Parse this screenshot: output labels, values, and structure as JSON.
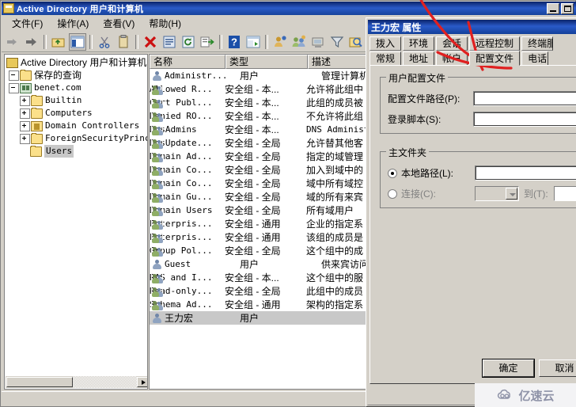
{
  "main_window": {
    "title": "Active Directory 用户和计算机",
    "window_buttons": [
      "minimize",
      "maximize"
    ],
    "menu": [
      {
        "label": "文件(F)"
      },
      {
        "label": "操作(A)"
      },
      {
        "label": "查看(V)"
      },
      {
        "label": "帮助(H)"
      }
    ],
    "toolbar_icons": [
      "back-arrow-icon",
      "forward-arrow-icon",
      "separator",
      "up-folder-icon",
      "show-hide-tree-icon",
      "separator",
      "cut-icon",
      "copy-paste-icon",
      "separator",
      "delete-icon",
      "properties-icon",
      "refresh-icon",
      "export-list-icon",
      "separator",
      "help-icon",
      "console-window-icon",
      "separator",
      "new-user-icon",
      "new-group-icon",
      "new-computer-icon",
      "filter-icon",
      "find-icon",
      "find-users-icon"
    ]
  },
  "tree": {
    "nodes": [
      {
        "label": "Active Directory 用户和计算机",
        "icon": "console-root-icon",
        "indent": 0,
        "twisty": "none",
        "selected": false,
        "cjk": true
      },
      {
        "label": "保存的查询",
        "icon": "folder-icon",
        "indent": 1,
        "twisty": "expand",
        "selected": false,
        "cjk": true
      },
      {
        "label": "benet.com",
        "icon": "domain-icon",
        "indent": 1,
        "twisty": "expand",
        "selected": false,
        "cjk": false
      },
      {
        "label": "Builtin",
        "icon": "folder-icon",
        "indent": 2,
        "twisty": "collapse",
        "selected": false,
        "cjk": false
      },
      {
        "label": "Computers",
        "icon": "folder-icon",
        "indent": 2,
        "twisty": "collapse",
        "selected": false,
        "cjk": false
      },
      {
        "label": "Domain Controllers",
        "icon": "ou-folder-icon",
        "indent": 2,
        "twisty": "collapse",
        "selected": false,
        "cjk": false
      },
      {
        "label": "ForeignSecurityPrincipals",
        "icon": "folder-icon",
        "indent": 2,
        "twisty": "collapse",
        "selected": false,
        "cjk": false
      },
      {
        "label": "Users",
        "icon": "folder-icon",
        "indent": 2,
        "twisty": "none",
        "selected": true,
        "cjk": false
      }
    ]
  },
  "list": {
    "columns": [
      {
        "label": "名称"
      },
      {
        "label": "类型"
      },
      {
        "label": "描述"
      }
    ],
    "rows": [
      {
        "name": "Administr...",
        "type": "用户",
        "desc": "管理计算机 (",
        "icon": "user-icon",
        "selected": false,
        "cjk_name": false,
        "mono_desc": false
      },
      {
        "name": "Allowed R...",
        "type": "安全组 - 本...",
        "desc": "允许将此组中",
        "icon": "group-icon",
        "selected": false,
        "cjk_name": false,
        "mono_desc": false
      },
      {
        "name": "Cert Publ...",
        "type": "安全组 - 本...",
        "desc": "此组的成员被",
        "icon": "group-icon",
        "selected": false,
        "cjk_name": false,
        "mono_desc": false
      },
      {
        "name": "Denied RO...",
        "type": "安全组 - 本...",
        "desc": "不允许将此组",
        "icon": "group-icon",
        "selected": false,
        "cjk_name": false,
        "mono_desc": false
      },
      {
        "name": "DnsAdmins",
        "type": "安全组 - 本...",
        "desc": "DNS Administ",
        "icon": "group-icon",
        "selected": false,
        "cjk_name": false,
        "mono_desc": true
      },
      {
        "name": "DnsUpdate...",
        "type": "安全组 - 全局",
        "desc": "允许替其他客",
        "icon": "group-icon",
        "selected": false,
        "cjk_name": false,
        "mono_desc": false
      },
      {
        "name": "Domain Ad...",
        "type": "安全组 - 全局",
        "desc": "指定的域管理",
        "icon": "group-icon",
        "selected": false,
        "cjk_name": false,
        "mono_desc": false
      },
      {
        "name": "Domain Co...",
        "type": "安全组 - 全局",
        "desc": "加入到域中的",
        "icon": "group-icon",
        "selected": false,
        "cjk_name": false,
        "mono_desc": false
      },
      {
        "name": "Domain Co...",
        "type": "安全组 - 全局",
        "desc": "域中所有域控",
        "icon": "group-icon",
        "selected": false,
        "cjk_name": false,
        "mono_desc": false
      },
      {
        "name": "Domain Gu...",
        "type": "安全组 - 全局",
        "desc": "域的所有来宾",
        "icon": "group-icon",
        "selected": false,
        "cjk_name": false,
        "mono_desc": false
      },
      {
        "name": "Domain Users",
        "type": "安全组 - 全局",
        "desc": "所有域用户",
        "icon": "group-icon",
        "selected": false,
        "cjk_name": false,
        "mono_desc": false
      },
      {
        "name": "Enterpris...",
        "type": "安全组 - 通用",
        "desc": "企业的指定系",
        "icon": "group-icon",
        "selected": false,
        "cjk_name": false,
        "mono_desc": false
      },
      {
        "name": "Enterpris...",
        "type": "安全组 - 通用",
        "desc": "该组的成员是",
        "icon": "group-icon",
        "selected": false,
        "cjk_name": false,
        "mono_desc": false
      },
      {
        "name": "Group Pol...",
        "type": "安全组 - 全局",
        "desc": "这个组中的成",
        "icon": "group-icon",
        "selected": false,
        "cjk_name": false,
        "mono_desc": false
      },
      {
        "name": "Guest",
        "type": "用户",
        "desc": "供来宾访问计",
        "icon": "user-icon",
        "selected": false,
        "cjk_name": false,
        "mono_desc": false
      },
      {
        "name": "RAS and I...",
        "type": "安全组 - 本...",
        "desc": "这个组中的服",
        "icon": "group-icon",
        "selected": false,
        "cjk_name": false,
        "mono_desc": false
      },
      {
        "name": "Read-only...",
        "type": "安全组 - 全局",
        "desc": "此组中的成员",
        "icon": "group-icon",
        "selected": false,
        "cjk_name": false,
        "mono_desc": false
      },
      {
        "name": "Schema Ad...",
        "type": "安全组 - 通用",
        "desc": "架构的指定系",
        "icon": "group-icon",
        "selected": false,
        "cjk_name": false,
        "mono_desc": false
      },
      {
        "name": "王力宏",
        "type": "用户",
        "desc": "",
        "icon": "user-icon",
        "selected": true,
        "cjk_name": true,
        "mono_desc": false
      }
    ]
  },
  "dialog": {
    "title": "王力宏 属性",
    "tabs_row1": [
      {
        "label": "拨入",
        "selected": false
      },
      {
        "label": "环境",
        "selected": false
      },
      {
        "label": "会话",
        "selected": false
      },
      {
        "label": "远程控制",
        "selected": false
      },
      {
        "label": "终端服务配置文件",
        "selected": false
      }
    ],
    "tabs_row2": [
      {
        "label": "常规",
        "selected": false
      },
      {
        "label": "地址",
        "selected": false
      },
      {
        "label": "帐户",
        "selected": false
      },
      {
        "label": "配置文件",
        "selected": true
      },
      {
        "label": "电话",
        "selected": false
      }
    ],
    "user_profile": {
      "group_label": "用户配置文件",
      "profile_path_label": "配置文件路径(P):",
      "profile_path_value": "",
      "logon_script_label": "登录脚本(S):",
      "logon_script_value": ""
    },
    "home_folder": {
      "group_label": "主文件夹",
      "local_path_label": "本地路径(L):",
      "local_path_value": "",
      "local_path_selected": true,
      "connect_label": "连接(C):",
      "connect_selected": false,
      "connect_drive_value": "",
      "to_label": "到(T):",
      "to_value": ""
    },
    "buttons": [
      {
        "label": "确定",
        "default": true
      },
      {
        "label": "取消",
        "default": false
      }
    ]
  },
  "annotation": {
    "type": "hand-drawn-red-arrow",
    "points_to": "配置文件",
    "color": "#e02020"
  },
  "watermark": {
    "text": "亿速云",
    "icon": "cloud-icon"
  }
}
